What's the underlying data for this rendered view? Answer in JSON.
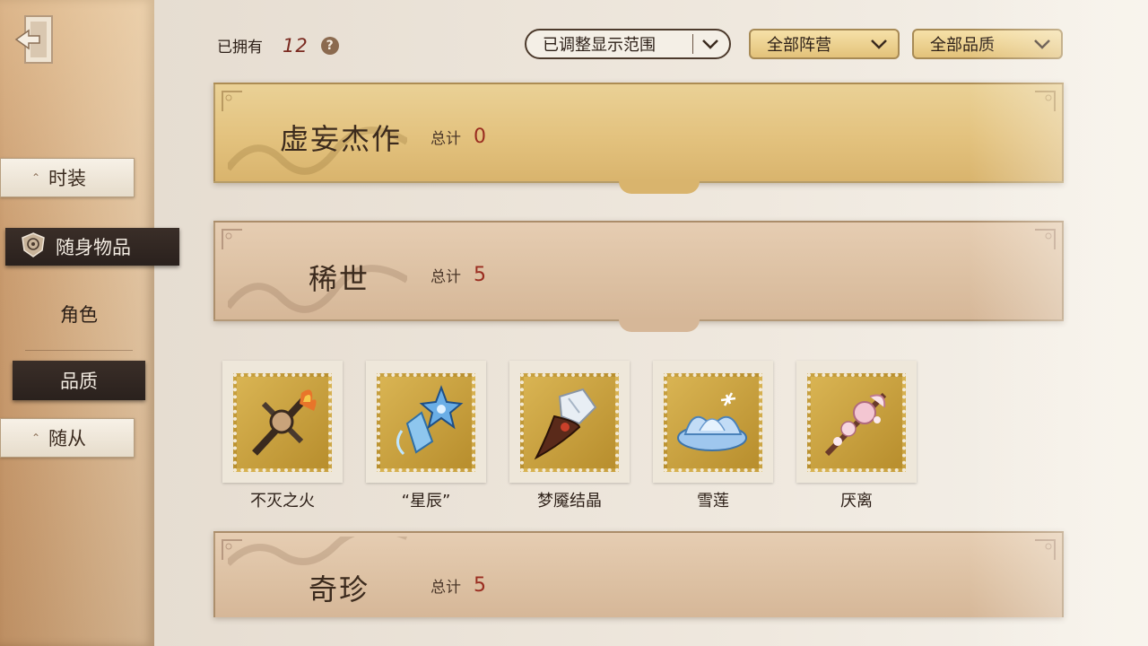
{
  "sidebar": {
    "items": [
      {
        "label": "时装",
        "state": "plain"
      },
      {
        "label": "随身物品",
        "state": "selected"
      },
      {
        "label": "角色",
        "state": "text"
      },
      {
        "label": "品质",
        "state": "selected-dark"
      },
      {
        "label": "随从",
        "state": "plain"
      }
    ]
  },
  "header": {
    "owned_label": "已拥有",
    "owned_count": "12",
    "help_icon": "?",
    "filters": {
      "range": "已调整显示范围",
      "faction": "全部阵营",
      "quality": "全部品质"
    }
  },
  "sections": [
    {
      "title": "虚妄杰作",
      "total_label": "总计",
      "total": "0",
      "color": "#e6c683"
    },
    {
      "title": "稀世",
      "total_label": "总计",
      "total": "5",
      "color": "#ddc1a2"
    },
    {
      "title": "奇珍",
      "total_label": "总计",
      "total": "5",
      "color": "#dcc0a0"
    }
  ],
  "items": [
    {
      "name": "不灭之火",
      "icon": "flame-cross-icon"
    },
    {
      "name": "“星辰”",
      "icon": "star-crystal-icon"
    },
    {
      "name": "梦魇结晶",
      "icon": "nightmare-crystal-icon"
    },
    {
      "name": "雪莲",
      "icon": "snow-lotus-icon"
    },
    {
      "name": "厌离",
      "icon": "pink-blossom-icon"
    }
  ]
}
